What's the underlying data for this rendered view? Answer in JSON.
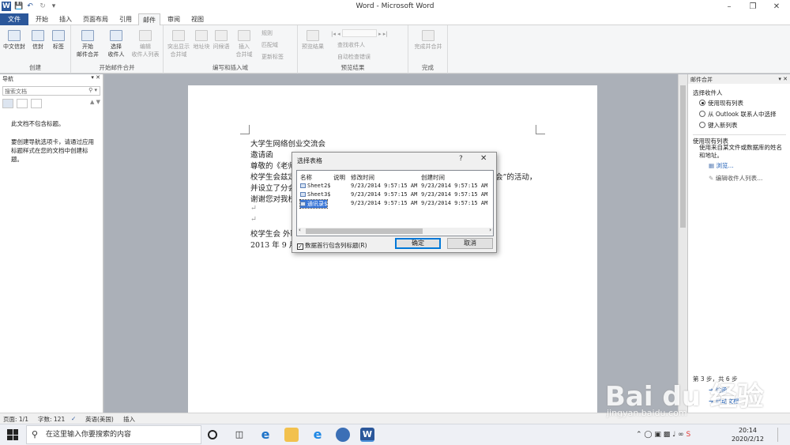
{
  "window": {
    "title": "Word - Microsoft Word"
  },
  "tabs": [
    "文件",
    "开始",
    "插入",
    "页面布局",
    "引用",
    "邮件",
    "审阅",
    "视图"
  ],
  "ribbon": {
    "groups": [
      {
        "label": "创建",
        "buttons": [
          "中文信封",
          "信封",
          "标签"
        ]
      },
      {
        "label": "开始邮件合并",
        "buttons": [
          "开始\n邮件合并",
          "选择\n收件人",
          "编辑\n收件人列表"
        ]
      },
      {
        "label": "编写和插入域",
        "buttons": [
          "突出显示\n合并域",
          "地址块",
          "问候语",
          "插入\n合并域"
        ],
        "small": [
          "规则",
          "匹配域",
          "更新标签"
        ]
      },
      {
        "label": "预览结果",
        "buttons": [
          "预览结果"
        ],
        "small": [
          "查找收件人",
          "自动检查错误"
        ]
      },
      {
        "label": "完成",
        "buttons": [
          "完成并合并"
        ]
      }
    ]
  },
  "nav": {
    "title": "导航",
    "search_placeholder": "搜索文档",
    "msg1": "此文档不包含标题。",
    "msg2": "要创建导航选项卡，请通过应用标题样式在您的文档中创建标题。"
  },
  "document": {
    "lines": [
      "大学生网络创业交流会",
      "邀请函",
      "尊敬的《老师",
      "校学生会兹定",
      "并设立了分会",
      "谢谢您对我校",
      "",
      "",
      "校学生会 外联",
      "2013 年 9 月 8"
    ],
    "fragment_right": "会”的活动，"
  },
  "mailpane": {
    "title": "邮件合并",
    "section1": "选择收件人",
    "options": [
      "使用现有列表",
      "从 Outlook 联系人中选择",
      "键入新列表"
    ],
    "selected_option": 0,
    "section2": "使用现有列表",
    "description": "使用来自某文件或数据库的姓名和地址。",
    "browse": "浏览...",
    "edit": "编辑收件人列表...",
    "step": "第 3 步，共 6 步",
    "next_partial": "信函",
    "prev_partial": "启动文档"
  },
  "dialog": {
    "title": "选择表格",
    "help": "?",
    "columns": [
      "名称",
      "说明",
      "修改时间",
      "创建时间"
    ],
    "rows": [
      {
        "name": "Sheet2$",
        "desc": "",
        "modified": "9/23/2014  9:57:15 AM",
        "created": "9/23/2014  9:57:15 AM"
      },
      {
        "name": "Sheet3$",
        "desc": "",
        "modified": "9/23/2014  9:57:15 AM",
        "created": "9/23/2014  9:57:15 AM"
      },
      {
        "name": "通讯录$",
        "desc": "",
        "modified": "9/23/2014  9:57:15 AM",
        "created": "9/23/2014  9:57:15 AM"
      }
    ],
    "selected_row": 2,
    "checkbox_label": "数据首行包含列标题(R)",
    "checkbox_checked": true,
    "ok": "确定",
    "cancel": "取消"
  },
  "statusbar": {
    "page": "页面: 1/1",
    "words": "字数: 121",
    "language": "英语(美国)",
    "mode": "插入"
  },
  "taskbar": {
    "search_placeholder": "在这里输入你要搜索的内容",
    "time": "20:14",
    "date": "2020/2/12"
  },
  "watermark": {
    "text": "Bai du 经验",
    "sub": "jingyan.baidu.com"
  },
  "colors": {
    "word_blue": "#2b579a",
    "selection": "#3875d7",
    "dialog_default_border": "#0078d7"
  }
}
